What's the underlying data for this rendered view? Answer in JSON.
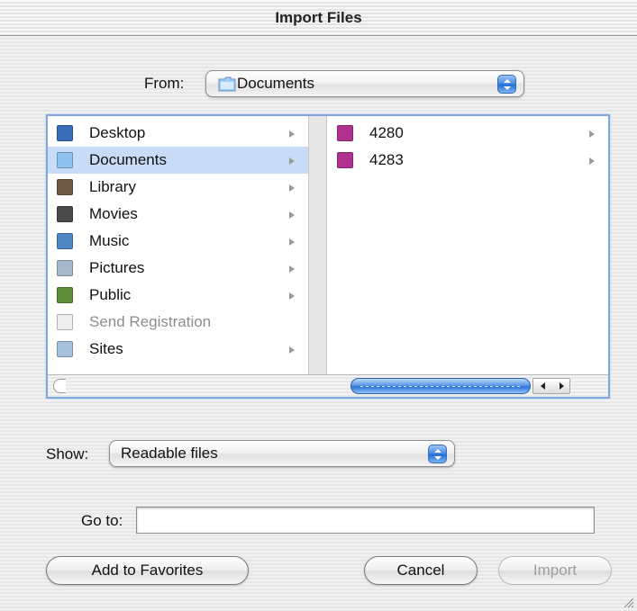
{
  "window": {
    "title": "Import Files"
  },
  "from": {
    "label": "From:",
    "value": "Documents"
  },
  "browser": {
    "column1": [
      {
        "label": "Desktop",
        "icon": "desktop-icon",
        "color": "#3b6db9",
        "arrow": true,
        "selected": false,
        "dim": false
      },
      {
        "label": "Documents",
        "icon": "folder-icon",
        "color": "#8fc2ef",
        "arrow": true,
        "selected": true,
        "dim": false
      },
      {
        "label": "Library",
        "icon": "library-folder-icon",
        "color": "#6f5a43",
        "arrow": true,
        "selected": false,
        "dim": false
      },
      {
        "label": "Movies",
        "icon": "movies-folder-icon",
        "color": "#4a4a4a",
        "arrow": true,
        "selected": false,
        "dim": false
      },
      {
        "label": "Music",
        "icon": "music-folder-icon",
        "color": "#4f86c6",
        "arrow": true,
        "selected": false,
        "dim": false
      },
      {
        "label": "Pictures",
        "icon": "pictures-folder-icon",
        "color": "#a6b8c9",
        "arrow": true,
        "selected": false,
        "dim": false
      },
      {
        "label": "Public",
        "icon": "public-folder-icon",
        "color": "#5f8e3a",
        "arrow": true,
        "selected": false,
        "dim": false
      },
      {
        "label": "Send Registration",
        "icon": "document-icon",
        "color": "#eeeeee",
        "arrow": false,
        "selected": false,
        "dim": true
      },
      {
        "label": "Sites",
        "icon": "sites-folder-icon",
        "color": "#a6c1dc",
        "arrow": true,
        "selected": false,
        "dim": false
      }
    ],
    "column2": [
      {
        "label": "4280",
        "icon": "magenta-folder-icon",
        "color": "#b0318f",
        "arrow": true
      },
      {
        "label": "4283",
        "icon": "magenta-folder-icon",
        "color": "#b0318f",
        "arrow": true
      }
    ]
  },
  "show": {
    "label": "Show:",
    "value": "Readable files"
  },
  "goto": {
    "label": "Go to:",
    "value": ""
  },
  "buttons": {
    "add_favorites": "Add to Favorites",
    "cancel": "Cancel",
    "import": "Import"
  }
}
